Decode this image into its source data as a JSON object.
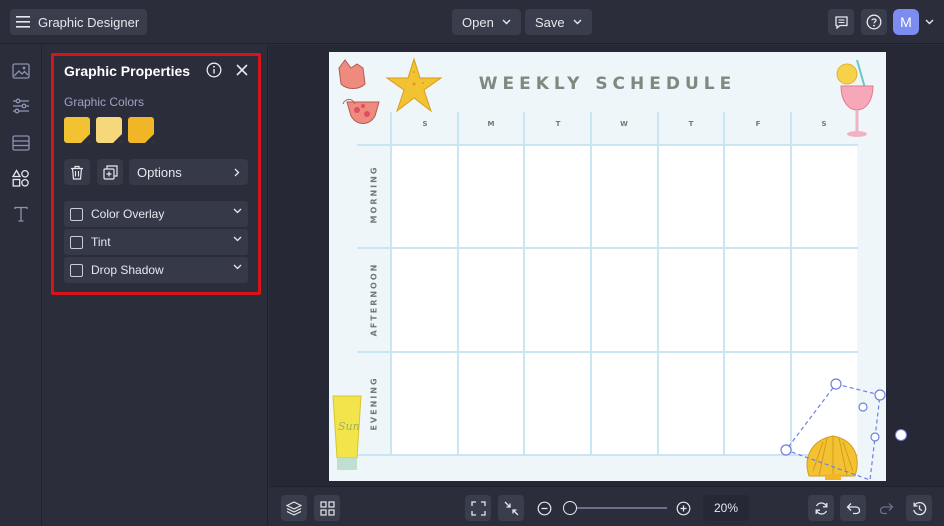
{
  "topbar": {
    "app_title": "Graphic Designer",
    "open_label": "Open",
    "save_label": "Save",
    "avatar_initial": "M"
  },
  "panel": {
    "title": "Graphic Properties",
    "colors_label": "Graphic Colors",
    "swatches": [
      "#f2c232",
      "#f6d77a",
      "#f0b628"
    ],
    "options_label": "Options",
    "accordions": [
      {
        "label": "Color Overlay"
      },
      {
        "label": "Tint"
      },
      {
        "label": "Drop Shadow"
      }
    ]
  },
  "canvas": {
    "title": "WEEKLY SCHEDULE",
    "days": [
      "S",
      "M",
      "T",
      "W",
      "T",
      "F",
      "S"
    ],
    "rows": [
      "MORNING",
      "AFTERNOON",
      "EVENING"
    ],
    "sunscreen_text": "Sun"
  },
  "bottombar": {
    "zoom": "20%"
  },
  "colors": {
    "accent_red": "#d8141b",
    "grid_line": "#c9e6f2",
    "bg": "#2b2d3a"
  }
}
